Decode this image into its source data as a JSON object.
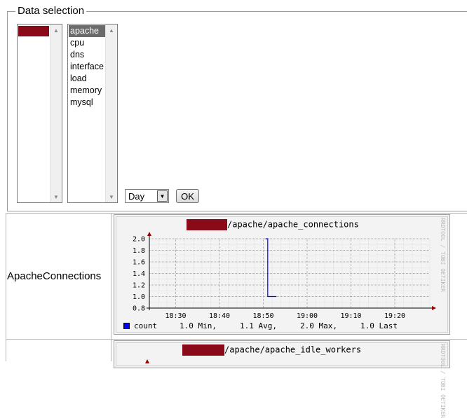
{
  "data_selection": {
    "legend": "Data selection",
    "plugins": [
      "apache",
      "cpu",
      "dns",
      "interface",
      "load",
      "memory",
      "mysql"
    ],
    "selected_plugin": "apache",
    "timespan": {
      "selected": "Day"
    },
    "ok_label": "OK"
  },
  "rows": [
    {
      "label": "ApacheConnections",
      "graph": {
        "title_suffix": "/apache/apache_connections",
        "side_text": "RRDTOOL / TOBI OETIKER",
        "legend": {
          "series": "count",
          "min": "1.0 Min,",
          "avg": "1.1 Avg,",
          "max": "2.0 Max,",
          "last": "1.0 Last"
        }
      }
    },
    {
      "label": "",
      "graph": {
        "title_suffix": "/apache/apache_idle_workers",
        "side_text": "RRDTOOL / TOBI OETIKER"
      }
    }
  ],
  "chart_data": {
    "type": "line",
    "title": "/apache/apache_connections",
    "x_ticks": [
      "18:30",
      "18:40",
      "18:50",
      "19:00",
      "19:10",
      "19:20"
    ],
    "y_ticks": [
      "2.0",
      "1.8",
      "1.6",
      "1.4",
      "1.2",
      "1.0",
      "0.8"
    ],
    "ylim": [
      0.8,
      2.0
    ],
    "xlim": [
      "18:24",
      "19:28"
    ],
    "series": [
      {
        "name": "count",
        "color": "#0000ff",
        "points": [
          [
            "18:50:30",
            2.0
          ],
          [
            "18:51:00",
            2.0
          ],
          [
            "18:51:00",
            1.0
          ],
          [
            "18:53:00",
            1.0
          ]
        ]
      }
    ],
    "grid": true
  }
}
